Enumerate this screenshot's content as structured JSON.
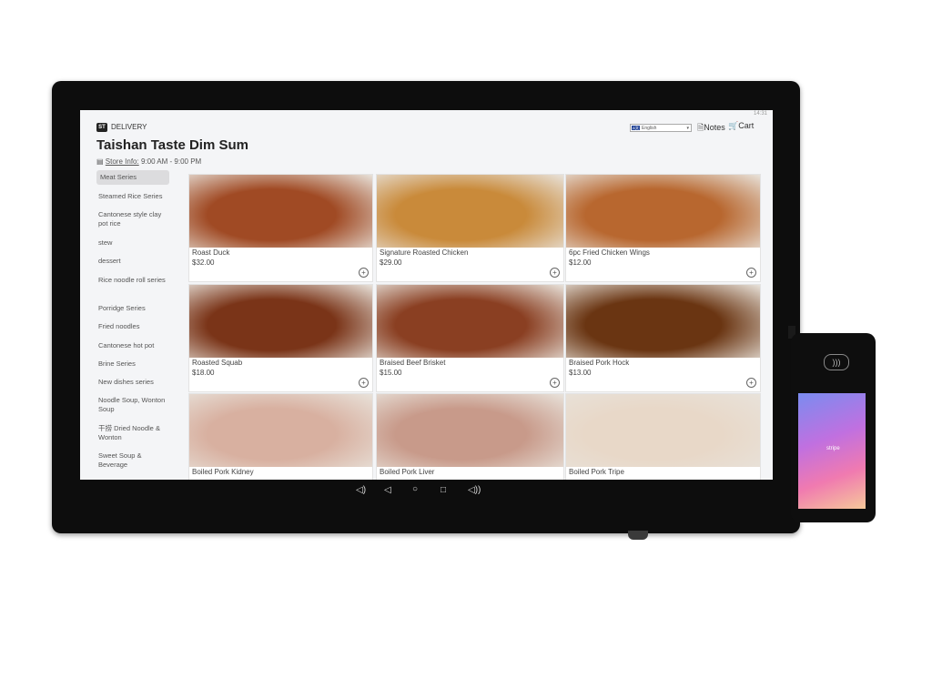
{
  "app": {
    "brand_badge": "ST",
    "mode": "DELIVERY",
    "title": "Taishan Taste Dim Sum",
    "store_info_label": "Store Info:",
    "store_hours": "9:00 AM - 9:00 PM",
    "language": "English",
    "language_flag": "A文",
    "notes_label": "Notes",
    "cart_label": "Cart",
    "status_time": "14:31"
  },
  "categories": [
    {
      "label": "Meat Series",
      "active": true
    },
    {
      "label": "Steamed Rice Series"
    },
    {
      "label": "Cantonese style clay pot rice"
    },
    {
      "label": "stew"
    },
    {
      "label": "dessert"
    },
    {
      "label": "Rice noodle roll series"
    },
    {
      "label": "Porridge Series"
    },
    {
      "label": "Fried noodles"
    },
    {
      "label": "Cantonese hot pot"
    },
    {
      "label": "Brine Series"
    },
    {
      "label": "New dishes series"
    },
    {
      "label": "Noodle Soup, Wonton Soup"
    },
    {
      "label": "干捞 Dried Noodle & Wonton"
    },
    {
      "label": "Sweet Soup & Beverage"
    }
  ],
  "items": [
    {
      "name": "Roast Duck",
      "price": "$32.00",
      "color": "#a04a24"
    },
    {
      "name": "Signature Roasted Chicken",
      "price": "$29.00",
      "color": "#c98a3a"
    },
    {
      "name": "6pc Fried Chicken Wings",
      "price": "$12.00",
      "color": "#b8672f"
    },
    {
      "name": "Roasted Squab",
      "price": "$18.00",
      "color": "#7a3418"
    },
    {
      "name": "Braised Beef Brisket",
      "price": "$15.00",
      "color": "#8a3f22"
    },
    {
      "name": "Braised Pork Hock",
      "price": "$13.00",
      "color": "#6a3512"
    },
    {
      "name": "Boiled Pork Kidney",
      "price": "",
      "color": "#d8b0a0"
    },
    {
      "name": "Boiled Pork Liver",
      "price": "",
      "color": "#c89a8a"
    },
    {
      "name": "Boiled Pork Tripe",
      "price": "",
      "color": "#e8d8c8"
    }
  ],
  "icons": {
    "add": "+",
    "notes": "notes-icon",
    "cart": "cart-icon",
    "nav_volume_down": "◁)",
    "nav_back": "◁",
    "nav_home": "○",
    "nav_recent": "□",
    "nav_volume_up": "◁))",
    "nfc": ")))"
  },
  "terminal": {
    "brand": "stripe"
  }
}
